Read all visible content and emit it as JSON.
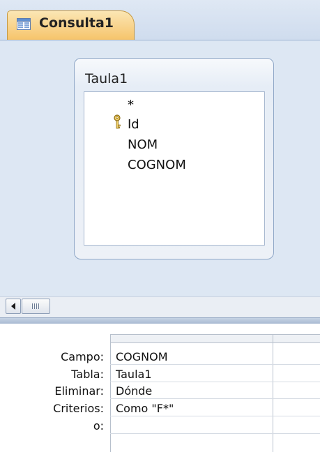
{
  "tab": {
    "title": "Consulta1",
    "icon": "query-icon"
  },
  "table": {
    "name": "Taula1",
    "fields": [
      "*",
      "Id",
      "NOM",
      "COGNOM"
    ],
    "primary_key": "Id"
  },
  "grid": {
    "row_labels": {
      "field": "Campo:",
      "table": "Tabla:",
      "delete": "Eliminar:",
      "criteria": "Criterios:",
      "or": "o:"
    },
    "column1": {
      "field": "COGNOM",
      "table": "Taula1",
      "delete": "Dónde",
      "criteria": "Como \"F*\"",
      "or": ""
    }
  }
}
